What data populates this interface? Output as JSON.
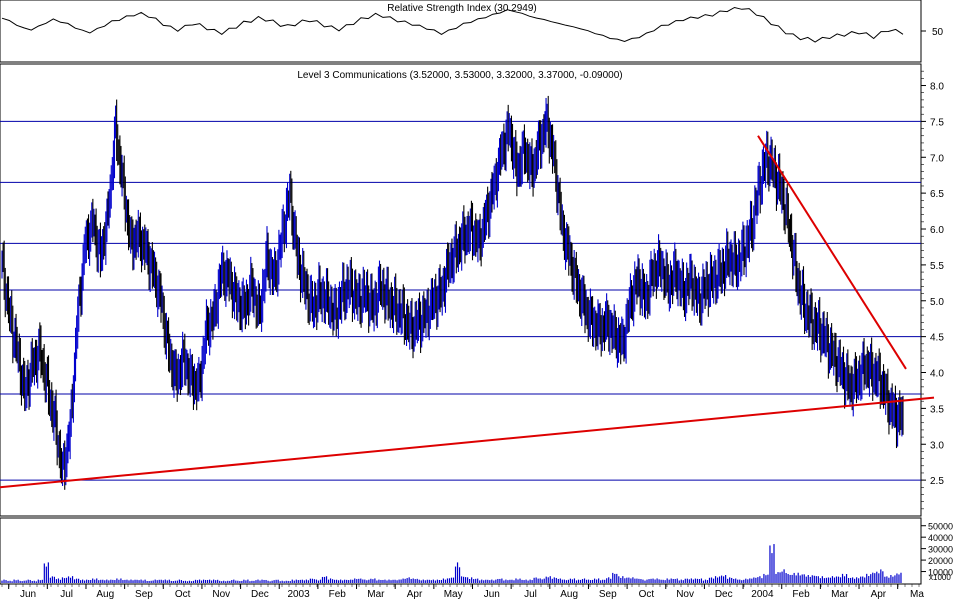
{
  "chart_data": {
    "type": "line",
    "rsi_panel": {
      "title": "Relative Strength Index (30.2949)",
      "ylim": [
        0,
        100
      ],
      "tick_labels": [
        "50"
      ],
      "ticks": [
        50
      ],
      "values": [
        72,
        68,
        60,
        55,
        52,
        58,
        64,
        70,
        66,
        62,
        56,
        50,
        48,
        53,
        60,
        66,
        70,
        74,
        78,
        80,
        76,
        70,
        62,
        56,
        52,
        57,
        63,
        60,
        55,
        50,
        47,
        52,
        58,
        64,
        68,
        72,
        70,
        66,
        61,
        58,
        62,
        66,
        69,
        65,
        60,
        56,
        53,
        58,
        64,
        70,
        74,
        78,
        76,
        72,
        68,
        65,
        62,
        58,
        55,
        50,
        46,
        50,
        56,
        62,
        66,
        70,
        74,
        78,
        82,
        86,
        84,
        80,
        76,
        72,
        70,
        66,
        63,
        60,
        57,
        54,
        50,
        46,
        42,
        38,
        35,
        33,
        36,
        40,
        45,
        52,
        58,
        62,
        66,
        70,
        72,
        74,
        76,
        78,
        82,
        86,
        88,
        90,
        86,
        80,
        72,
        64,
        56,
        48,
        42,
        38,
        36,
        34,
        36,
        40,
        42,
        44,
        46,
        48,
        44,
        40,
        46,
        52,
        50,
        47
      ]
    },
    "price_panel": {
      "title": "Level 3 Communications (3.52000, 3.53000, 3.32000, 3.37000, -0.09000)",
      "ylim": [
        2.0,
        8.3
      ],
      "y_ticks": [
        2.5,
        3.0,
        3.5,
        4.0,
        4.5,
        5.0,
        5.5,
        6.0,
        6.5,
        7.0,
        7.5,
        8.0
      ],
      "y_tick_labels": [
        "2.5",
        "3.0",
        "3.5",
        "4.0",
        "4.5",
        "5.0",
        "5.5",
        "6.0",
        "6.5",
        "7.0",
        "7.5",
        "8.0"
      ],
      "horizontal_levels": [
        2.5,
        3.7,
        4.5,
        5.15,
        5.8,
        6.65,
        7.5
      ],
      "trendlines": [
        {
          "from": {
            "x_index": 0,
            "y": 2.4
          },
          "to": {
            "x_index": 934,
            "y": 3.65
          }
        },
        {
          "from": {
            "x_index": 758,
            "y": 7.3
          },
          "to": {
            "x_index": 906,
            "y": 4.05
          }
        }
      ],
      "closes": [
        5.5,
        4.8,
        4.3,
        3.7,
        4.1,
        4.3,
        3.8,
        3.3,
        2.6,
        3.2,
        4.8,
        5.8,
        6.1,
        5.6,
        6.2,
        7.4,
        6.6,
        5.8,
        5.9,
        5.7,
        5.4,
        5.0,
        4.3,
        3.9,
        4.2,
        3.9,
        3.8,
        4.6,
        4.8,
        5.4,
        5.3,
        5.0,
        4.9,
        5.2,
        4.8,
        5.6,
        5.3,
        5.9,
        6.5,
        5.6,
        5.2,
        4.9,
        5.1,
        5.0,
        4.8,
        5.1,
        5.2,
        5.0,
        5.1,
        4.9,
        5.2,
        5.0,
        4.9,
        4.8,
        4.6,
        4.7,
        4.8,
        5.0,
        5.1,
        5.5,
        5.7,
        5.9,
        6.0,
        5.8,
        6.2,
        6.6,
        7.1,
        7.4,
        6.8,
        7.1,
        6.8,
        7.2,
        7.5,
        6.9,
        6.0,
        5.6,
        5.2,
        4.9,
        4.7,
        4.6,
        4.7,
        4.5,
        4.4,
        5.0,
        5.3,
        5.0,
        5.4,
        5.5,
        5.2,
        5.4,
        5.1,
        5.3,
        5.0,
        5.2,
        5.3,
        5.4,
        5.6,
        5.5,
        5.7,
        6.0,
        6.6,
        7.0,
        6.8,
        6.5,
        6.0,
        5.3,
        4.9,
        4.7,
        4.6,
        4.4,
        4.2,
        4.0,
        3.8,
        3.9,
        4.1,
        4.0,
        3.9,
        3.6,
        3.4,
        3.37
      ]
    },
    "volume_panel": {
      "y_ticks": [
        10000,
        20000,
        30000,
        40000,
        50000
      ],
      "y_tick_labels": [
        "10000",
        "20000",
        "30000",
        "40000",
        "50000"
      ],
      "unit_note": "x1000",
      "values": [
        3,
        2,
        3,
        2,
        3,
        2,
        3,
        18,
        6,
        4,
        5,
        6,
        4,
        3,
        3,
        4,
        3,
        3,
        3,
        4,
        3,
        3,
        3,
        3,
        2,
        3,
        3,
        3,
        2,
        3,
        2,
        2,
        3,
        3,
        3,
        3,
        2,
        2,
        3,
        2,
        3,
        2,
        3,
        3,
        2,
        3,
        2,
        2,
        3,
        3,
        3,
        4,
        3,
        6,
        4,
        3,
        3,
        3,
        4,
        4,
        3,
        4,
        3,
        3,
        3,
        3,
        4,
        5,
        4,
        3,
        3,
        3,
        3,
        4,
        5,
        18,
        6,
        5,
        4,
        3,
        3,
        3,
        4,
        3,
        3,
        4,
        3,
        3,
        5,
        4,
        6,
        5,
        4,
        3,
        4,
        3,
        4,
        3,
        4,
        3,
        5,
        9,
        6,
        5,
        5,
        4,
        3,
        4,
        4,
        3,
        4,
        4,
        3,
        4,
        4,
        4,
        3,
        5,
        6,
        7,
        5,
        4,
        3,
        4,
        5,
        6,
        8,
        34,
        10,
        12,
        8,
        9,
        8,
        7,
        7,
        6,
        5,
        6,
        6,
        8,
        5,
        5,
        6,
        8,
        10,
        12,
        6,
        7,
        9
      ]
    },
    "x_axis": {
      "tick_labels": [
        "Jun",
        "Jul",
        "Aug",
        "Sep",
        "Oct",
        "Nov",
        "Dec",
        "2003",
        "Feb",
        "Mar",
        "Apr",
        "May",
        "Jun",
        "Jul",
        "Aug",
        "Sep",
        "Oct",
        "Nov",
        "Dec",
        "2004",
        "Feb",
        "Mar",
        "Apr",
        "Ma"
      ]
    },
    "colors": {
      "up_bar": "#0000cc",
      "down_bar": "#000000",
      "trendline": "#dd0000",
      "level_line": "#0000aa",
      "volume": "#0000cc",
      "rsi": "#000000"
    }
  }
}
